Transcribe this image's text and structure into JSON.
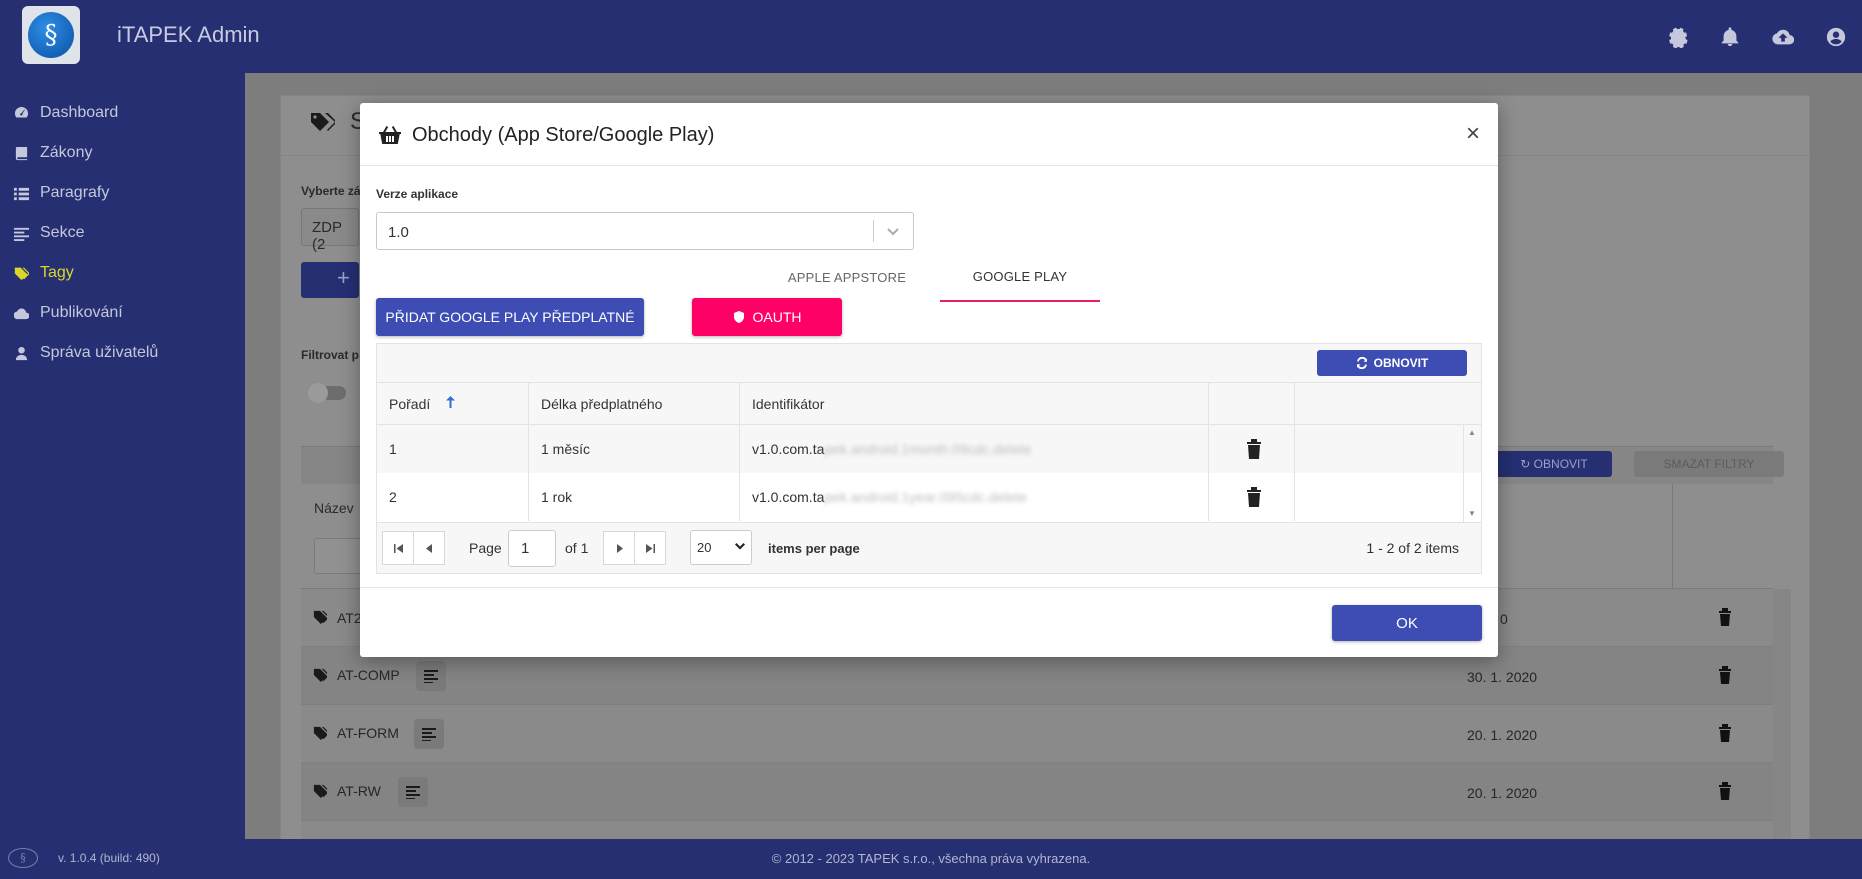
{
  "app": {
    "title": "iTAPEK Admin",
    "logo_glyph": "§"
  },
  "header_icons": [
    "gear-icon",
    "bell-icon",
    "cloud-upload-icon",
    "user-icon"
  ],
  "sidebar": {
    "items": [
      {
        "label": "Dashboard",
        "icon": "dashboard-icon"
      },
      {
        "label": "Zákony",
        "icon": "book-icon"
      },
      {
        "label": "Paragrafy",
        "icon": "list-icon"
      },
      {
        "label": "Sekce",
        "icon": "align-left-icon"
      },
      {
        "label": "Tagy",
        "icon": "tags-icon",
        "active": true
      },
      {
        "label": "Publikování",
        "icon": "cloud-icon"
      },
      {
        "label": "Správa uživatelů",
        "icon": "user-icon"
      }
    ],
    "version": "v. 1.0.4 (build: 490)"
  },
  "footer": {
    "copyright": "© 2012 - 2023 TAPEK s.r.o., všechna práva vyhrazena."
  },
  "background_page": {
    "title_partial": "S",
    "select_label_partial": "Vyberte zá",
    "select_value_partial": "ZDP (2",
    "add_button_partial": "+",
    "filter_label_partial": "Filtrovat p",
    "column_name": "Název",
    "refresh_label": "OBNOVIT",
    "clear_filters_label": "SMAZAT FILTRY",
    "rows": [
      {
        "name": "AT2",
        "date": "0"
      },
      {
        "name": "AT-COMP",
        "date": "30. 1. 2020"
      },
      {
        "name": "AT-FORM",
        "date": "20. 1. 2020"
      },
      {
        "name": "AT-RW",
        "date": "20. 1. 2020"
      }
    ]
  },
  "modal": {
    "title": "Obchody (App Store/Google Play)",
    "close": "×",
    "version_label": "Verze aplikace",
    "version_value": "1.0",
    "tabs": [
      {
        "label": "APPLE APPSTORE",
        "active": false
      },
      {
        "label": "GOOGLE PLAY",
        "active": true
      }
    ],
    "add_button": "PŘIDAT GOOGLE PLAY PŘEDPLATNÉ",
    "oauth_button": "OAUTH",
    "refresh_button": "OBNOVIT",
    "columns": [
      "Pořadí",
      "Délka předplatného",
      "Identifikátor"
    ],
    "rows": [
      {
        "order": "1",
        "length": "1 měsíc",
        "id_prefix": "v1.0.com.ta",
        "id_redacted": "pek.android.1month.09cdc.delete"
      },
      {
        "order": "2",
        "length": "1 rok",
        "id_prefix": "v1.0.com.ta",
        "id_redacted": "pek.android.1year.095cdc.delete"
      }
    ],
    "pager": {
      "page_label": "Page",
      "page": "1",
      "of_label": "of 1",
      "page_size": "20",
      "items_per_page": "items per page",
      "info": "1 - 2 of 2 items"
    },
    "ok_button": "OK"
  }
}
